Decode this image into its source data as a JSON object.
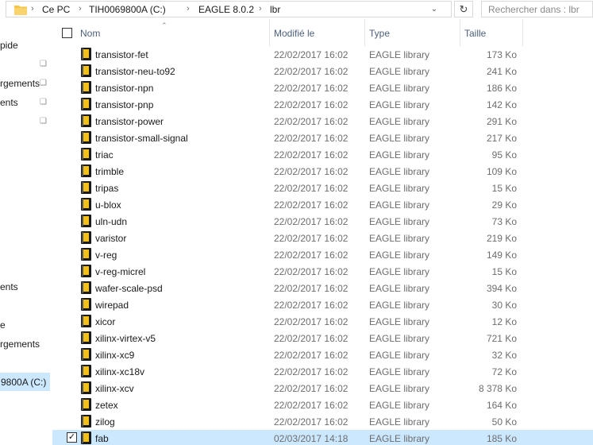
{
  "address": {
    "crumbs": [
      "Ce PC",
      "TIH0069800A (C:)",
      "EAGLE 8.0.2",
      "lbr"
    ],
    "search_placeholder": "Rechercher dans : lbr"
  },
  "nav": {
    "items": [
      "pide",
      "rgements",
      "ents",
      "ents",
      "e",
      "rgements"
    ],
    "selected_drive": "9800A (C:)"
  },
  "columns": {
    "name": "Nom",
    "date": "Modifié le",
    "type": "Type",
    "size": "Taille"
  },
  "files": [
    {
      "name": "transistor-fet",
      "date": "22/02/2017 16:02",
      "type": "EAGLE library",
      "size": "173 Ko"
    },
    {
      "name": "transistor-neu-to92",
      "date": "22/02/2017 16:02",
      "type": "EAGLE library",
      "size": "241 Ko"
    },
    {
      "name": "transistor-npn",
      "date": "22/02/2017 16:02",
      "type": "EAGLE library",
      "size": "186 Ko"
    },
    {
      "name": "transistor-pnp",
      "date": "22/02/2017 16:02",
      "type": "EAGLE library",
      "size": "142 Ko"
    },
    {
      "name": "transistor-power",
      "date": "22/02/2017 16:02",
      "type": "EAGLE library",
      "size": "291 Ko"
    },
    {
      "name": "transistor-small-signal",
      "date": "22/02/2017 16:02",
      "type": "EAGLE library",
      "size": "217 Ko"
    },
    {
      "name": "triac",
      "date": "22/02/2017 16:02",
      "type": "EAGLE library",
      "size": "95 Ko"
    },
    {
      "name": "trimble",
      "date": "22/02/2017 16:02",
      "type": "EAGLE library",
      "size": "109 Ko"
    },
    {
      "name": "tripas",
      "date": "22/02/2017 16:02",
      "type": "EAGLE library",
      "size": "15 Ko"
    },
    {
      "name": "u-blox",
      "date": "22/02/2017 16:02",
      "type": "EAGLE library",
      "size": "29 Ko"
    },
    {
      "name": "uln-udn",
      "date": "22/02/2017 16:02",
      "type": "EAGLE library",
      "size": "73 Ko"
    },
    {
      "name": "varistor",
      "date": "22/02/2017 16:02",
      "type": "EAGLE library",
      "size": "219 Ko"
    },
    {
      "name": "v-reg",
      "date": "22/02/2017 16:02",
      "type": "EAGLE library",
      "size": "149 Ko"
    },
    {
      "name": "v-reg-micrel",
      "date": "22/02/2017 16:02",
      "type": "EAGLE library",
      "size": "15 Ko"
    },
    {
      "name": "wafer-scale-psd",
      "date": "22/02/2017 16:02",
      "type": "EAGLE library",
      "size": "394 Ko"
    },
    {
      "name": "wirepad",
      "date": "22/02/2017 16:02",
      "type": "EAGLE library",
      "size": "30 Ko"
    },
    {
      "name": "xicor",
      "date": "22/02/2017 16:02",
      "type": "EAGLE library",
      "size": "12 Ko"
    },
    {
      "name": "xilinx-virtex-v5",
      "date": "22/02/2017 16:02",
      "type": "EAGLE library",
      "size": "721 Ko"
    },
    {
      "name": "xilinx-xc9",
      "date": "22/02/2017 16:02",
      "type": "EAGLE library",
      "size": "32 Ko"
    },
    {
      "name": "xilinx-xc18v",
      "date": "22/02/2017 16:02",
      "type": "EAGLE library",
      "size": "72 Ko"
    },
    {
      "name": "xilinx-xcv",
      "date": "22/02/2017 16:02",
      "type": "EAGLE library",
      "size": "8 378 Ko"
    },
    {
      "name": "zetex",
      "date": "22/02/2017 16:02",
      "type": "EAGLE library",
      "size": "164 Ko"
    },
    {
      "name": "zilog",
      "date": "22/02/2017 16:02",
      "type": "EAGLE library",
      "size": "50 Ko"
    },
    {
      "name": "fab",
      "date": "02/03/2017 14:18",
      "type": "EAGLE library",
      "size": "185 Ko",
      "selected": true,
      "checked": true
    }
  ],
  "colors": {
    "selection": "#cce8ff",
    "header_text": "#4c607a",
    "secondary_text": "#6d6d6d",
    "folder": "#f6c343",
    "eagle_icon": "#f2c01b"
  }
}
